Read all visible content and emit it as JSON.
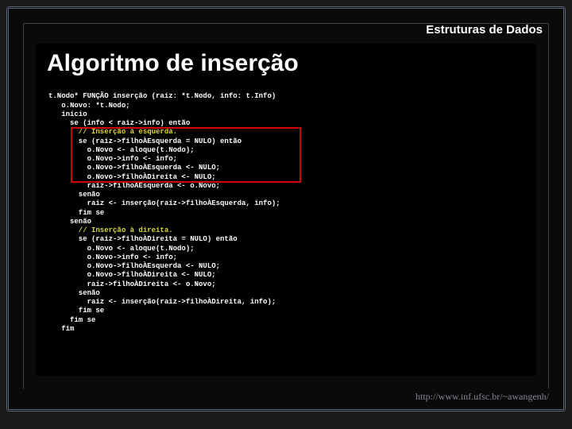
{
  "header": {
    "title": "Estruturas de Dados"
  },
  "slide": {
    "title": "Algoritmo de inserção"
  },
  "code": {
    "l0": "t.Nodo* FUNÇÃO inserção (raiz: *t.Nodo, info: t.Info)",
    "l1": "   o.Novo: *t.Nodo;",
    "l2": "   início",
    "l3": "     se (info < raiz->info) então",
    "l4": "       // Inserção à esquerda.",
    "l5": "       se (raiz->filhoÀEsquerda = NULO) então",
    "l6": "         o.Novo <- aloque(t.Nodo);",
    "l7": "         o.Novo->info <- info;",
    "l8": "         o.Novo->filhoÀEsquerda <- NULO;",
    "l9": "         o.Novo->filhoÀDireita <- NULO;",
    "l10": "         raiz->filhoÀEsquerda <- o.Novo;",
    "l11": "       senão",
    "l12": "         raiz <- inserção(raiz->filhoÀEsquerda, info);",
    "l13": "       fim se",
    "l14": "     senão",
    "l15": "       // Inserção à direita.",
    "l16": "       se (raiz->filhoÀDireita = NULO) então",
    "l17": "         o.Novo <- aloque(t.Nodo);",
    "l18": "         o.Novo->info <- info;",
    "l19": "         o.Novo->filhoÀEsquerda <- NULO;",
    "l20": "         o.Novo->filhoÀDireita <- NULO;",
    "l21": "         raiz->filhoÀDireita <- o.Novo;",
    "l22": "       senão",
    "l23": "         raiz <- inserção(raiz->filhoÀDireita, info);",
    "l24": "       fim se",
    "l25": "     fim se",
    "l26": "   fim"
  },
  "footer": {
    "url": "http://www.inf.ufsc.br/~awangenh/"
  }
}
